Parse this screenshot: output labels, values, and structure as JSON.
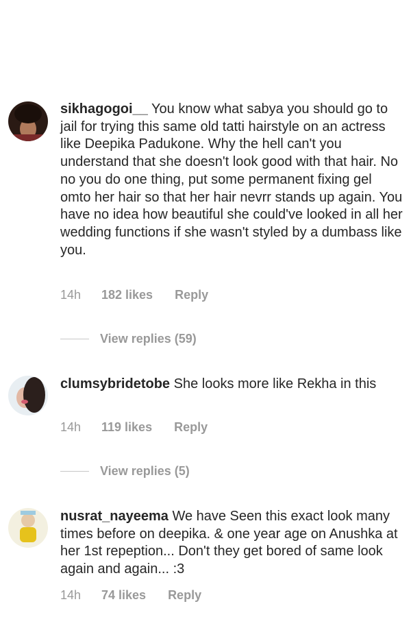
{
  "comments": [
    {
      "username": "sikhagogoi__",
      "text": "You know what sabya you should go to jail for trying this same old tatti hairstyle on an actress like Deepika Padukone. Why the hell can't you understand that she doesn't look good with that hair. No no you do one thing, put some permanent fixing gel omto her hair so that her hair nevrr stands up again. You have no idea how beautiful she could've looked in all her wedding functions if she wasn't styled by a dumbass like you.",
      "time": "14h",
      "likes": "182 likes",
      "reply": "Reply",
      "view_replies": "View replies (59)"
    },
    {
      "username": "clumsybridetobe",
      "text": "She looks more like Rekha in this",
      "time": "14h",
      "likes": "119 likes",
      "reply": "Reply",
      "view_replies": "View replies (5)"
    },
    {
      "username": "nusrat_nayeema",
      "text": "We have Seen this exact look many times before on deepika. & one year age on Anushka at her 1st repeption... Don't they get bored of same look again and again... :3",
      "time": "14h",
      "likes": "74 likes",
      "reply": "Reply"
    }
  ]
}
